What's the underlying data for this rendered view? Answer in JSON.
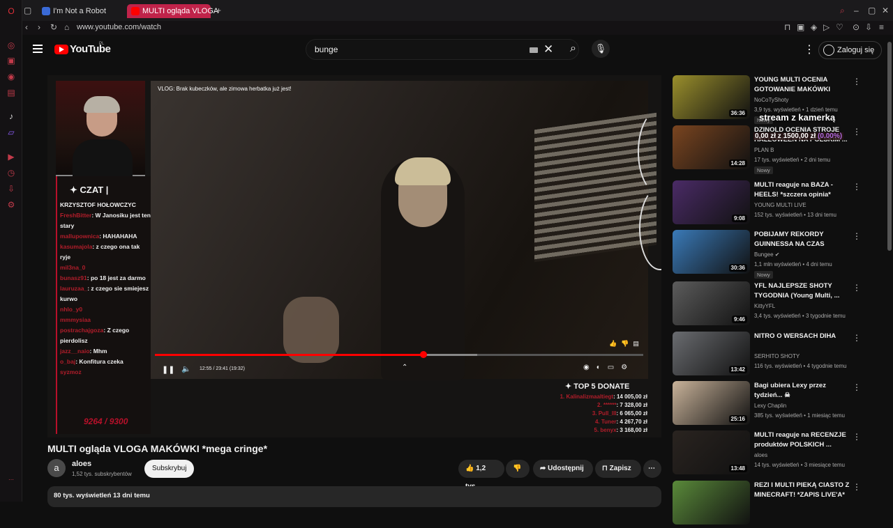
{
  "browser": {
    "tabs": [
      {
        "label": "I'm Not a Robot"
      },
      {
        "label": "MULTI ogląda VLOGA"
      }
    ],
    "url": "www.youtube.com/watch"
  },
  "masthead": {
    "logo_text": "YouTube",
    "country": "PL",
    "search_value": "bunge",
    "signin_label": "Zaloguj się"
  },
  "player": {
    "vlog_title": "VLOG: Brak kubeczków, ale zimowa herbatka już jest!",
    "chat_header": "✦ CZAT |",
    "chat_lines": [
      {
        "user": "KRZYSZTOF HOŁOWCZYC",
        "msg": ""
      },
      {
        "user": "FreshBitter",
        "msg": "W Janosiku jest ten stary"
      },
      {
        "user": "mallupownica",
        "msg": "HAHAHAHA"
      },
      {
        "user": "kasumajola",
        "msg": "z czego ona tak ryje"
      },
      {
        "user": "mil3na_0",
        "msg": ""
      },
      {
        "user": "bunasz91",
        "msg": "po 18 jest za darmo"
      },
      {
        "user": "lauruzaa_",
        "msg": "z czego sie smiejesz kurwo"
      },
      {
        "user": "nhlo_y0",
        "msg": ""
      },
      {
        "user": "mmmysiaa",
        "msg": ""
      },
      {
        "user": "postrachajgoza",
        "msg": "Z czego pierdolisz"
      },
      {
        "user": "jazz__naio",
        "msg": "Mhm"
      },
      {
        "user": "o_baj",
        "msg": "Konfitura czeka"
      },
      {
        "user": "syzmoz",
        "msg": ""
      }
    ],
    "goal": "9264 / 9300",
    "time": "12:55 / 23:41 (19:32)",
    "progress": 0.55,
    "buffered": 0.66,
    "donate_header": "✦ TOP 5 DONATE",
    "donations": [
      {
        "name": "1. Kalinalizmaaltiegt",
        "amount": "14 005,00 zł"
      },
      {
        "name": "2. ******",
        "amount": "7 328,00 zł"
      },
      {
        "name": "3. Pull_lll",
        "amount": "6 065,00 zł"
      },
      {
        "name": "4. Tuner",
        "amount": "4 267,70 zł"
      },
      {
        "name": "5. benyx",
        "amount": "3 168,00 zł"
      }
    ]
  },
  "video": {
    "title": "MULTI ogląda VLOGA MAKÓWKI *mega cringe*",
    "channel_initial": "a",
    "channel": "aloes",
    "subscribers": "1,52 tys. subskrybentów",
    "subscribe_label": "Subskrybuj",
    "likes": "1,2 tys.",
    "share_label": "Udostępnij",
    "save_label": "Zapisz",
    "views_date": "80 tys. wyświetleń  13 dni temu"
  },
  "overlay": {
    "stream_text": "stream z kamerką",
    "money_text": "0,00 zł z 1500,00 zł",
    "money_pct": "(0.00%)"
  },
  "recommendations": [
    {
      "title": "YOUNG MULTI OCENIA GOTOWANIE MAKÓWKI",
      "channel": "NoCoTyShoty",
      "meta": "3,9 tys. wyświetleń • 1 dzień temu",
      "duration": "36:36",
      "badge": "Nowy",
      "color": "#9a8f2c"
    },
    {
      "title": "DZINOLD OCENIA STROJE HALLOWEEN NA POLSKIM ...",
      "channel": "PLAN B",
      "meta": "17 tys. wyświetleń • 2 dni temu",
      "duration": "14:28",
      "badge": "Nowy",
      "color": "#7a4520"
    },
    {
      "title": "MULTI reaguje na BAZA - HEELS! *szczera opinia*",
      "channel": "YOUNG MULTI LIVE",
      "meta": "152 tys. wyświetleń • 13 dni temu",
      "duration": "9:08",
      "badge": "",
      "color": "#4a2b66"
    },
    {
      "title": "POBIJAMY REKORDY GUINNESSA NA CZAS",
      "channel": "Bungee ✔",
      "meta": "1,1 mln wyświetleń • 4 dni temu",
      "duration": "30:36",
      "badge": "Nowy",
      "color": "#3a7ab8"
    },
    {
      "title": "YFL NAJLEPSZE SHOTY TYGODNIA (Young Multi, ...",
      "channel": "KittyYFL",
      "meta": "3,4 tys. wyświetleń • 3 tygodnie temu",
      "duration": "9:46",
      "badge": "",
      "color": "#5c5c5c"
    },
    {
      "title": "NITRO O WERSACH DIHA",
      "channel": "SERHITO SHOTY",
      "meta": "116 tys. wyświetleń • 4 tygodnie temu",
      "duration": "13:42",
      "badge": "",
      "color": "#6a6c70"
    },
    {
      "title": "Bagi ubiera Lexy przez tydzień... ☠",
      "channel": "Lexy Chaplin",
      "meta": "385 tys. wyświetleń • 1 miesiąc temu",
      "duration": "25:16",
      "badge": "",
      "color": "#c9b39a"
    },
    {
      "title": "MULTI reaguje na RECENZJE produktów POLSKICH ...",
      "channel": "aloes",
      "meta": "14 tys. wyświetleń • 3 miesiące temu",
      "duration": "13:48",
      "badge": "",
      "color": "#2a2420"
    },
    {
      "title": "REZI I MULTI PIEKĄ CIASTO Z MINECRAFT! *ZAPIS LIVE'A*",
      "channel": "",
      "meta": "",
      "duration": "",
      "badge": "",
      "color": "#5a8a3a"
    }
  ]
}
